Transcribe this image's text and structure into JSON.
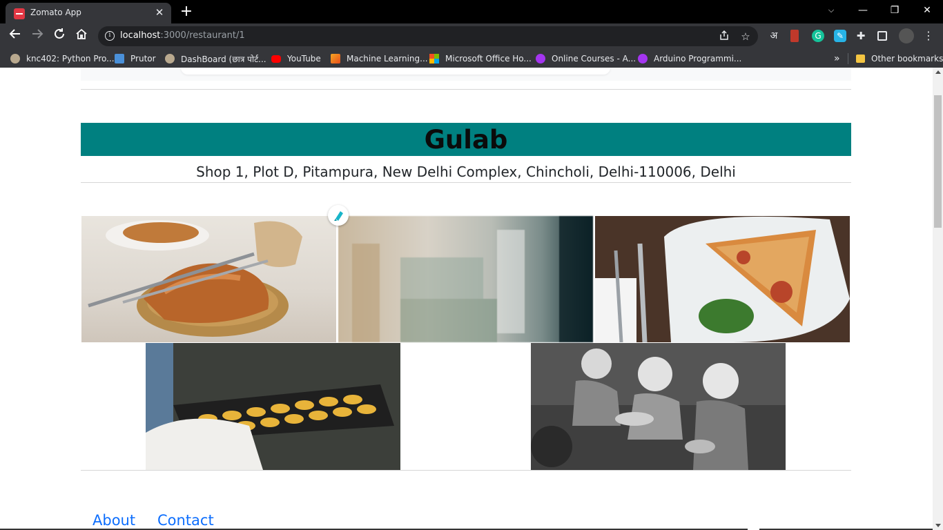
{
  "browser": {
    "tab_title": "Zomato App",
    "tab_close": "✕",
    "new_tab": "+",
    "url_host": "localhost",
    "url_path": ":3000/restaurant/1",
    "window_controls": {
      "minimize": "—",
      "restore": "❐",
      "close": "✕"
    },
    "extensions": {
      "translate": "अ"
    },
    "bookmarks": [
      {
        "label": "knc402: Python Pro...",
        "icon": "globe-icon"
      },
      {
        "label": "Prutor",
        "icon": "prutor-icon"
      },
      {
        "label": "DashBoard (छात्र पोर्ट...",
        "icon": "globe-icon"
      },
      {
        "label": "YouTube",
        "icon": "youtube-icon"
      },
      {
        "label": "Machine Learning...",
        "icon": "ml-icon"
      },
      {
        "label": "Microsoft Office Ho...",
        "icon": "microsoft-icon"
      },
      {
        "label": "Online Courses - A...",
        "icon": "udemy-icon"
      },
      {
        "label": "Arduino Programmi...",
        "icon": "udemy-icon"
      }
    ],
    "overflow": "»",
    "other_bookmarks": "Other bookmarks"
  },
  "restaurant": {
    "name": "Gulab",
    "address": "Shop 1, Plot D, Pitampura, New Delhi Complex, Chincholi, Delhi-110006, Delhi",
    "banner_color": "#008080",
    "images": [
      {
        "subject": "croissant-photo"
      },
      {
        "subject": "blurred-restaurant-photo"
      },
      {
        "subject": "pizza-slice-photo"
      },
      {
        "subject": "egg-tarts-tray-photo"
      },
      {
        "subject": "children-eating-photo"
      }
    ]
  },
  "footer": {
    "links": [
      "About",
      "Contact"
    ],
    "link_color": "#0d6efd"
  }
}
